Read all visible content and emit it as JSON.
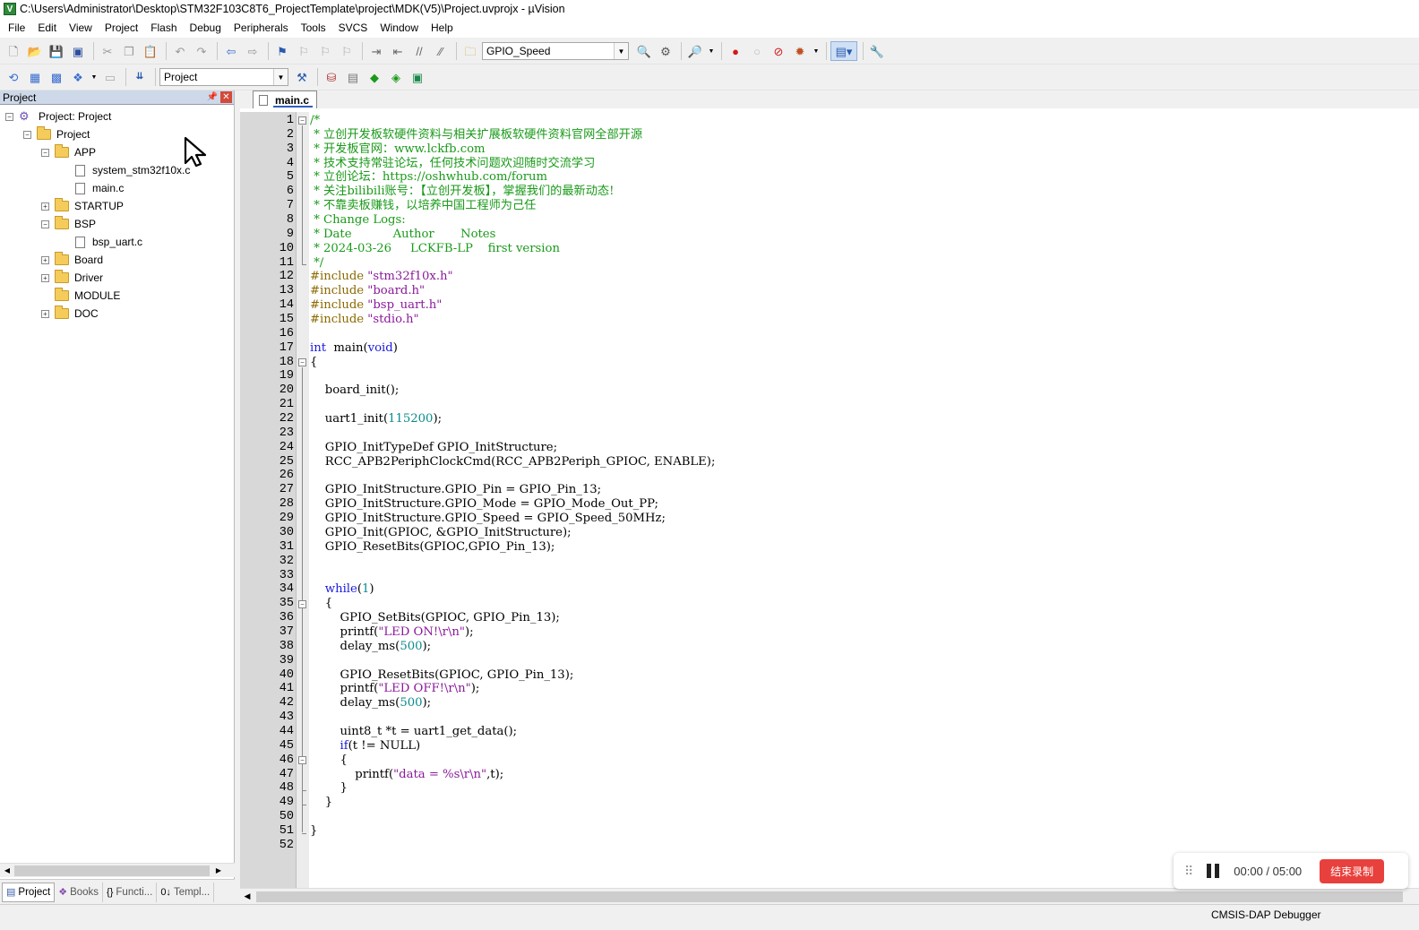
{
  "window": {
    "title": "C:\\Users\\Administrator\\Desktop\\STM32F103C8T6_ProjectTemplate\\project\\MDK(V5)\\Project.uvprojx - µVision"
  },
  "menu": [
    "File",
    "Edit",
    "View",
    "Project",
    "Flash",
    "Debug",
    "Peripherals",
    "Tools",
    "SVCS",
    "Window",
    "Help"
  ],
  "toolbar": {
    "find_combo": "GPIO_Speed",
    "target_combo": "Project"
  },
  "project_pane": {
    "title": "Project",
    "tree": [
      {
        "label": "Project: Project"
      },
      {
        "label": "Project"
      },
      {
        "label": "APP"
      },
      {
        "label": "system_stm32f10x.c"
      },
      {
        "label": "main.c"
      },
      {
        "label": "STARTUP"
      },
      {
        "label": "BSP"
      },
      {
        "label": "bsp_uart.c"
      },
      {
        "label": "Board"
      },
      {
        "label": "Driver"
      },
      {
        "label": "MODULE"
      },
      {
        "label": "DOC"
      }
    ],
    "tabs": [
      "Project",
      "Books",
      "Functi...",
      "Templ..."
    ]
  },
  "editor": {
    "tab": "main.c",
    "lines": [
      [
        [
          "cm",
          "/*"
        ]
      ],
      [
        [
          "cm",
          " * 立创开发板软硬件资料与相关扩展板软硬件资料官网全部开源"
        ]
      ],
      [
        [
          "cm",
          " * 开发板官网：www.lckfb.com"
        ]
      ],
      [
        [
          "cm",
          " * 技术支持常驻论坛，任何技术问题欢迎随时交流学习"
        ]
      ],
      [
        [
          "cm",
          " * 立创论坛：https://oshwhub.com/forum"
        ]
      ],
      [
        [
          "cm",
          " * 关注bilibili账号：【立创开发板】，掌握我们的最新动态!"
        ]
      ],
      [
        [
          "cm",
          " * 不靠卖板赚钱，以培养中国工程师为己任"
        ]
      ],
      [
        [
          "cm",
          " * Change Logs:"
        ]
      ],
      [
        [
          "cm",
          " * Date           Author       Notes"
        ]
      ],
      [
        [
          "cm",
          " * 2024-03-26     LCKFB-LP    first version"
        ]
      ],
      [
        [
          "cm",
          " */"
        ]
      ],
      [
        [
          "pp",
          "#include "
        ],
        [
          "str",
          "\"stm32f10x.h\""
        ]
      ],
      [
        [
          "pp",
          "#include "
        ],
        [
          "str",
          "\"board.h\""
        ]
      ],
      [
        [
          "pp",
          "#include "
        ],
        [
          "str",
          "\"bsp_uart.h\""
        ]
      ],
      [
        [
          "pp",
          "#include "
        ],
        [
          "str",
          "\"stdio.h\""
        ]
      ],
      [],
      [
        [
          "kw",
          "int"
        ],
        [
          "",
          "  main("
        ],
        [
          "kw",
          "void"
        ],
        [
          "",
          ")"
        ]
      ],
      [
        [
          "",
          "{"
        ]
      ],
      [],
      [
        [
          "",
          "    board_init();"
        ]
      ],
      [],
      [
        [
          "",
          "    uart1_init("
        ],
        [
          "num",
          "115200"
        ],
        [
          "",
          ");"
        ]
      ],
      [],
      [
        [
          "",
          "    GPIO_InitTypeDef GPIO_InitStructure;"
        ]
      ],
      [
        [
          "",
          "    RCC_APB2PeriphClockCmd(RCC_APB2Periph_GPIOC, ENABLE);"
        ]
      ],
      [],
      [
        [
          "",
          "    GPIO_InitStructure.GPIO_Pin = GPIO_Pin_13;"
        ]
      ],
      [
        [
          "",
          "    GPIO_InitStructure.GPIO_Mode = GPIO_Mode_Out_PP;"
        ]
      ],
      [
        [
          "",
          "    GPIO_InitStructure.GPIO_Speed = GPIO_Speed_50MHz;"
        ]
      ],
      [
        [
          "",
          "    GPIO_Init(GPIOC, &GPIO_InitStructure);"
        ]
      ],
      [
        [
          "",
          "    GPIO_ResetBits(GPIOC,GPIO_Pin_13);"
        ]
      ],
      [],
      [],
      [
        [
          "",
          "    "
        ],
        [
          "kw",
          "while"
        ],
        [
          "",
          "("
        ],
        [
          "num",
          "1"
        ],
        [
          "",
          ")"
        ]
      ],
      [
        [
          "",
          "    {"
        ]
      ],
      [
        [
          "",
          "        GPIO_SetBits(GPIOC, GPIO_Pin_13);"
        ]
      ],
      [
        [
          "",
          "        printf("
        ],
        [
          "str",
          "\"LED ON!\\r\\n\""
        ],
        [
          "",
          ");"
        ]
      ],
      [
        [
          "",
          "        delay_ms("
        ],
        [
          "num",
          "500"
        ],
        [
          "",
          ");"
        ]
      ],
      [],
      [
        [
          "",
          "        GPIO_ResetBits(GPIOC, GPIO_Pin_13);"
        ]
      ],
      [
        [
          "",
          "        printf("
        ],
        [
          "str",
          "\"LED OFF!\\r\\n\""
        ],
        [
          "",
          ");"
        ]
      ],
      [
        [
          "",
          "        delay_ms("
        ],
        [
          "num",
          "500"
        ],
        [
          "",
          ");"
        ]
      ],
      [],
      [
        [
          "",
          "        uint8_t *t = uart1_get_data();"
        ]
      ],
      [
        [
          "",
          "        "
        ],
        [
          "kw",
          "if"
        ],
        [
          "",
          "(t != NULL)"
        ]
      ],
      [
        [
          "",
          "        {"
        ]
      ],
      [
        [
          "",
          "            printf("
        ],
        [
          "str",
          "\"data = %s\\r\\n\""
        ],
        [
          "",
          ",t);"
        ]
      ],
      [
        [
          "",
          "        }"
        ]
      ],
      [
        [
          "",
          "    }"
        ]
      ],
      [],
      [
        [
          "",
          "}"
        ]
      ],
      []
    ]
  },
  "recorder": {
    "time": "00:00 / 05:00",
    "stop_label": "结束录制"
  },
  "status": {
    "debugger": "CMSIS-DAP Debugger"
  }
}
